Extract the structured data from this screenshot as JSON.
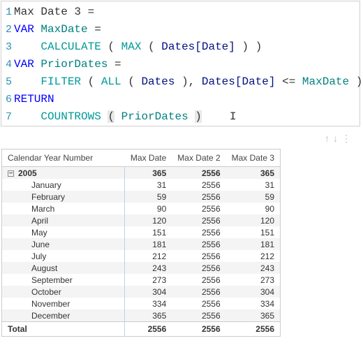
{
  "editor": {
    "lines": [
      {
        "n": "1",
        "segs": [
          {
            "t": "Max Date 3 = ",
            "c": "plain"
          }
        ]
      },
      {
        "n": "2",
        "segs": [
          {
            "t": "VAR",
            "c": "kw"
          },
          {
            "t": " ",
            "c": "plain"
          },
          {
            "t": "MaxDate",
            "c": "var"
          },
          {
            "t": " =",
            "c": "plain"
          }
        ]
      },
      {
        "n": "3",
        "segs": [
          {
            "t": "    ",
            "c": "plain"
          },
          {
            "t": "CALCULATE",
            "c": "fn"
          },
          {
            "t": " ( ",
            "c": "plain"
          },
          {
            "t": "MAX",
            "c": "fn"
          },
          {
            "t": " ( ",
            "c": "plain"
          },
          {
            "t": "Dates[Date]",
            "c": "ident"
          },
          {
            "t": " ) )",
            "c": "plain"
          }
        ]
      },
      {
        "n": "4",
        "segs": [
          {
            "t": "VAR",
            "c": "kw"
          },
          {
            "t": " ",
            "c": "plain"
          },
          {
            "t": "PriorDates",
            "c": "var"
          },
          {
            "t": " =",
            "c": "plain"
          }
        ]
      },
      {
        "n": "5",
        "segs": [
          {
            "t": "    ",
            "c": "plain"
          },
          {
            "t": "FILTER",
            "c": "fn"
          },
          {
            "t": " ( ",
            "c": "plain"
          },
          {
            "t": "ALL",
            "c": "fn"
          },
          {
            "t": " ( ",
            "c": "plain"
          },
          {
            "t": "Dates",
            "c": "ident"
          },
          {
            "t": " ), ",
            "c": "plain"
          },
          {
            "t": "Dates[Date]",
            "c": "ident"
          },
          {
            "t": " <= ",
            "c": "plain"
          },
          {
            "t": "MaxDate",
            "c": "var"
          },
          {
            "t": " )",
            "c": "plain"
          }
        ]
      },
      {
        "n": "6",
        "segs": [
          {
            "t": "RETURN",
            "c": "kw"
          }
        ]
      },
      {
        "n": "7",
        "segs": [
          {
            "t": "    ",
            "c": "plain"
          },
          {
            "t": "COUNTROWS",
            "c": "fn"
          },
          {
            "t": " ",
            "c": "plain"
          },
          {
            "t": "(",
            "c": "plain hl"
          },
          {
            "t": " ",
            "c": "plain"
          },
          {
            "t": "PriorDates",
            "c": "var"
          },
          {
            "t": " ",
            "c": "plain"
          },
          {
            "t": ")",
            "c": "plain hl"
          }
        ]
      }
    ],
    "cursor": "I"
  },
  "nav": {
    "up": "↑",
    "down": "↓",
    "menu": "⋮"
  },
  "table": {
    "headers": [
      "Calendar Year Number",
      "Max Date",
      "Max Date 2",
      "Max Date 3"
    ],
    "yearRow": {
      "label": "2005",
      "v1": "365",
      "v2": "2556",
      "v3": "365",
      "expand": "−"
    },
    "months": [
      {
        "label": "January",
        "v1": "31",
        "v2": "2556",
        "v3": "31"
      },
      {
        "label": "February",
        "v1": "59",
        "v2": "2556",
        "v3": "59"
      },
      {
        "label": "March",
        "v1": "90",
        "v2": "2556",
        "v3": "90"
      },
      {
        "label": "April",
        "v1": "120",
        "v2": "2556",
        "v3": "120"
      },
      {
        "label": "May",
        "v1": "151",
        "v2": "2556",
        "v3": "151"
      },
      {
        "label": "June",
        "v1": "181",
        "v2": "2556",
        "v3": "181"
      },
      {
        "label": "July",
        "v1": "212",
        "v2": "2556",
        "v3": "212"
      },
      {
        "label": "August",
        "v1": "243",
        "v2": "2556",
        "v3": "243"
      },
      {
        "label": "September",
        "v1": "273",
        "v2": "2556",
        "v3": "273"
      },
      {
        "label": "October",
        "v1": "304",
        "v2": "2556",
        "v3": "304"
      },
      {
        "label": "November",
        "v1": "334",
        "v2": "2556",
        "v3": "334"
      },
      {
        "label": "December",
        "v1": "365",
        "v2": "2556",
        "v3": "365"
      }
    ],
    "total": {
      "label": "Total",
      "v1": "2556",
      "v2": "2556",
      "v3": "2556"
    }
  }
}
